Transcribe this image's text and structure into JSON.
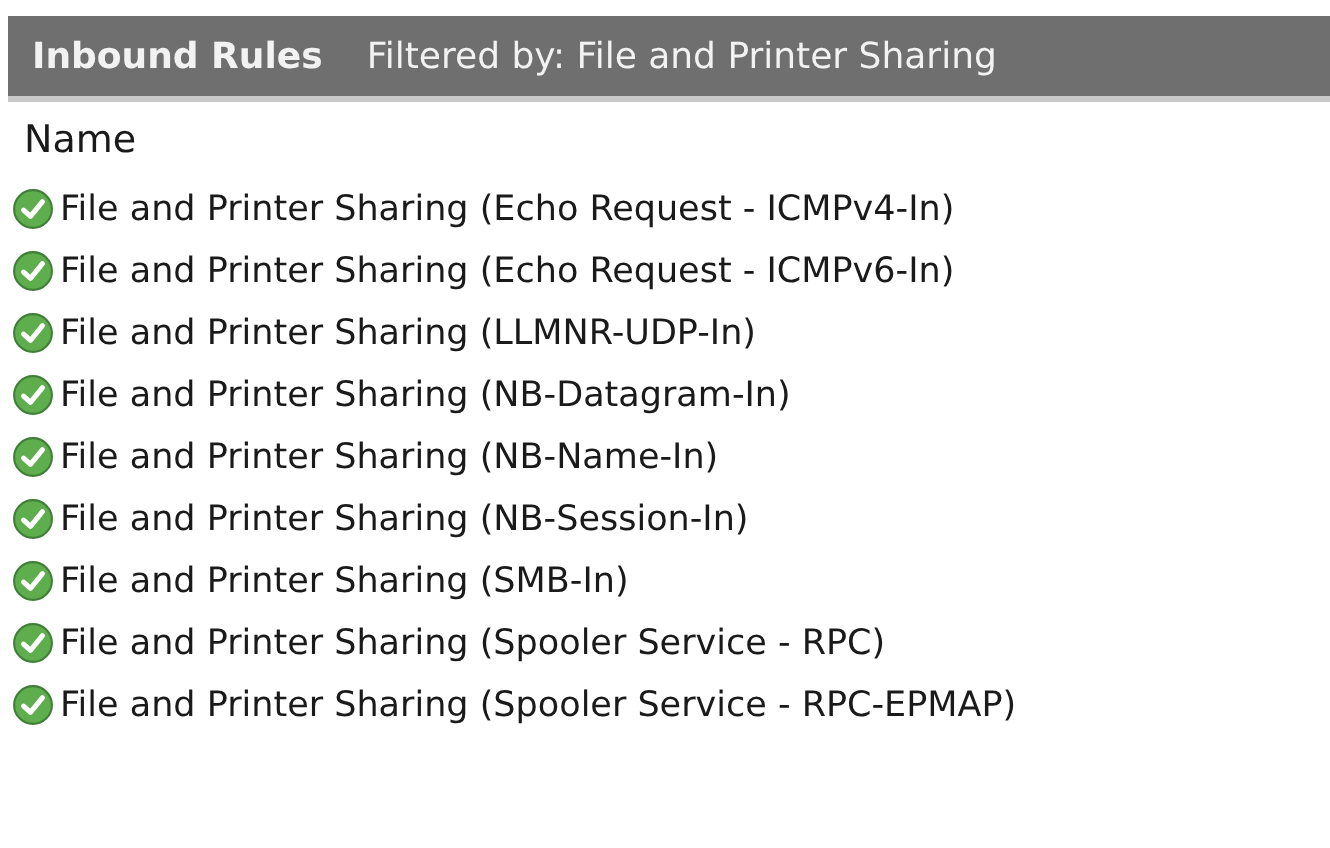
{
  "header": {
    "title": "Inbound Rules",
    "filter": "Filtered by: File and Printer Sharing"
  },
  "table": {
    "columns": [
      "Name"
    ],
    "rows": [
      {
        "name": "File and Printer Sharing (Echo Request - ICMPv4-In)",
        "enabled": true
      },
      {
        "name": "File and Printer Sharing (Echo Request - ICMPv6-In)",
        "enabled": true
      },
      {
        "name": "File and Printer Sharing (LLMNR-UDP-In)",
        "enabled": true
      },
      {
        "name": "File and Printer Sharing (NB-Datagram-In)",
        "enabled": true
      },
      {
        "name": "File and Printer Sharing (NB-Name-In)",
        "enabled": true
      },
      {
        "name": "File and Printer Sharing (NB-Session-In)",
        "enabled": true
      },
      {
        "name": "File and Printer Sharing (SMB-In)",
        "enabled": true
      },
      {
        "name": "File and Printer Sharing (Spooler Service - RPC)",
        "enabled": true
      },
      {
        "name": "File and Printer Sharing (Spooler Service - RPC-EPMAP)",
        "enabled": true
      }
    ]
  }
}
